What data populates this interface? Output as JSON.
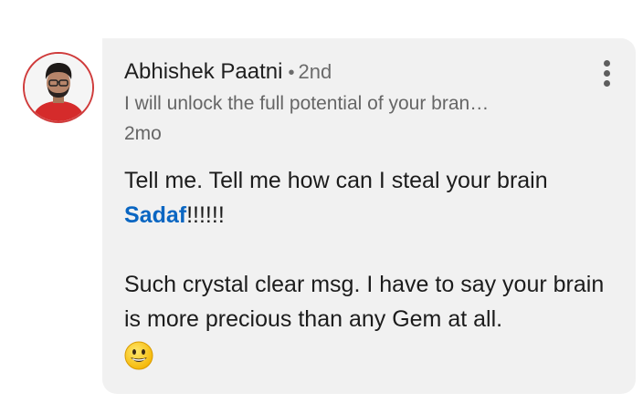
{
  "comment": {
    "author": {
      "name": "Abhishek Paatni",
      "separator": "•",
      "connection_degree": "2nd",
      "headline": "I will unlock the full potential of your bran…",
      "avatar_icon": "profile-photo"
    },
    "time": "2mo",
    "body": {
      "line1": "Tell me. Tell me how can I steal your brain",
      "mention": "Sadaf",
      "line2_suffix": "!!!!!!",
      "line3": "Such crystal clear msg. I have to say your brain is more precious than any Gem at all.",
      "emoji": "grinning-face-emoji"
    },
    "menu_icon": "more-vertical-icon"
  },
  "colors": {
    "bubble_background": "#f1f1f1",
    "mention": "#0a66c2",
    "avatar_ring": "#cf3b3b"
  }
}
